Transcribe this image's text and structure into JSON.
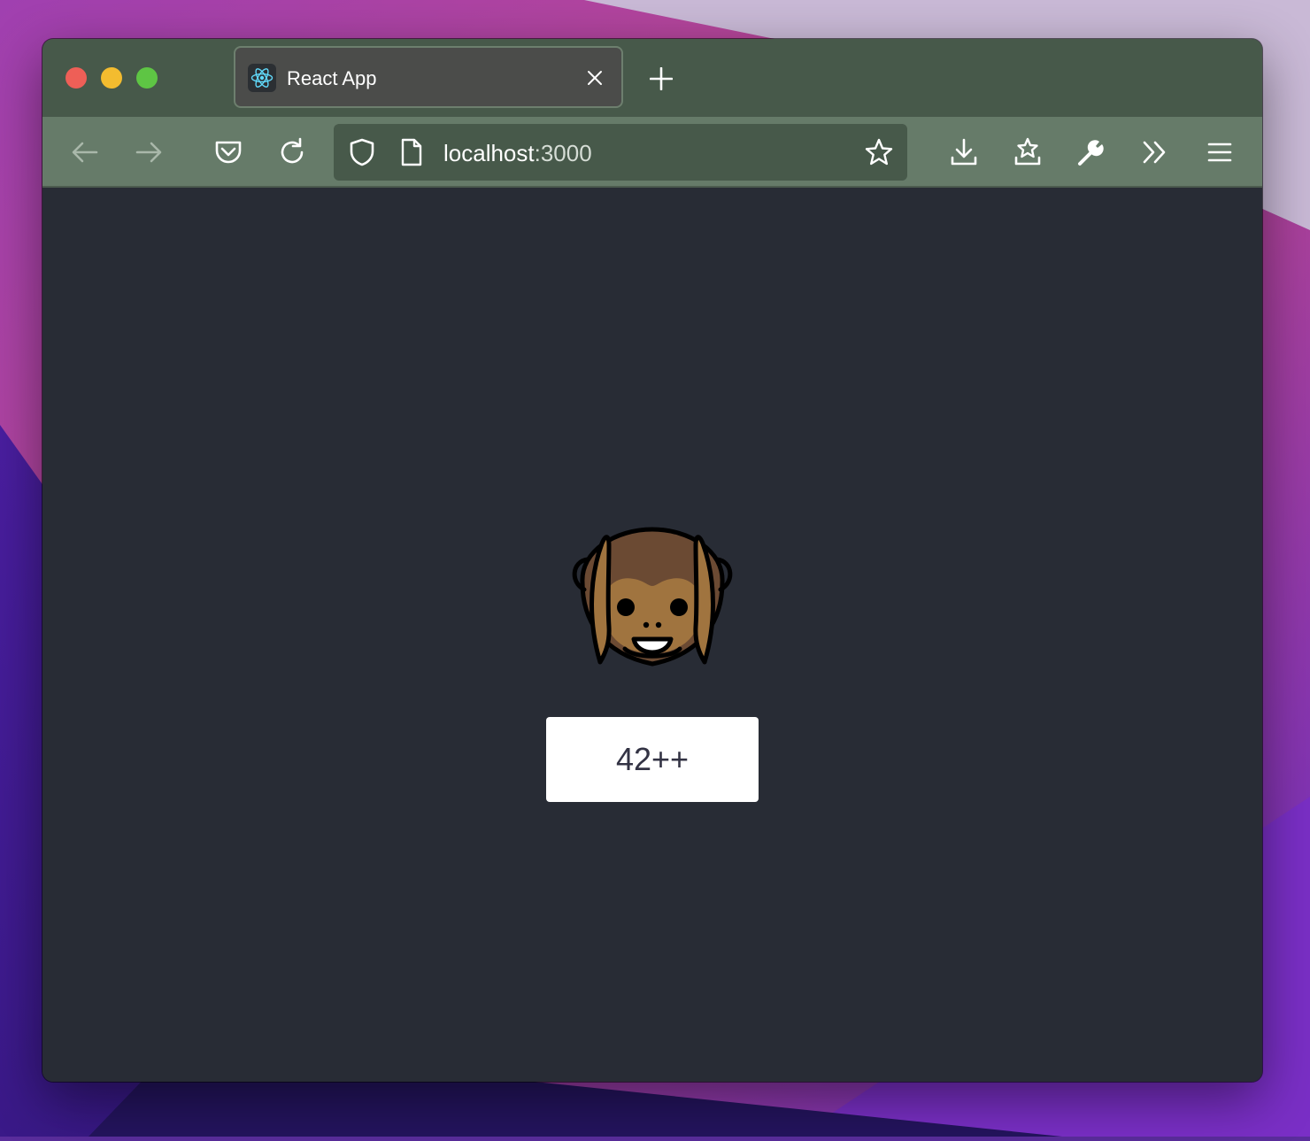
{
  "browser": {
    "tab": {
      "title": "React App",
      "favicon": "react-logo-icon"
    },
    "address": {
      "host": "localhost",
      "port": ":3000"
    },
    "toolbar_icons": [
      "back-arrow-icon",
      "forward-arrow-icon",
      "pocket-icon",
      "reload-icon",
      "shield-icon",
      "page-icon",
      "star-icon",
      "download-icon",
      "extensions-icon",
      "wrench-icon",
      "chevron-double-right-icon",
      "menu-icon"
    ]
  },
  "page": {
    "emoji": "hear-no-evil-monkey",
    "button_label": "42++"
  },
  "colors": {
    "tabbar": "#47594a",
    "toolbar": "#667b69",
    "content_bg": "#282c35",
    "button_bg": "#ffffff",
    "button_text": "#333344"
  }
}
